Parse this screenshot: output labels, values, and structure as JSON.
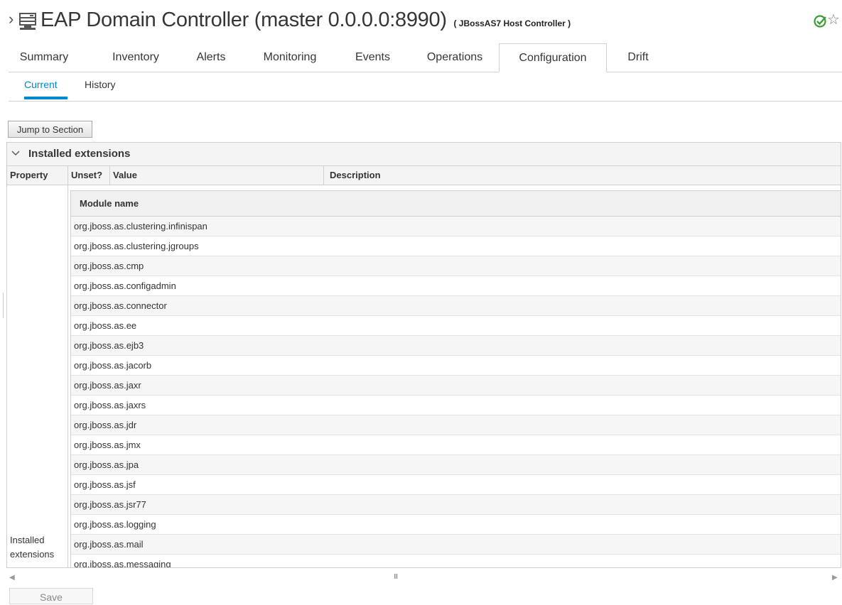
{
  "header": {
    "breadcrumb_caret": "›",
    "title": "EAP Domain Controller (master 0.0.0.0:8990)",
    "subtitle": "( JBossAS7 Host Controller )",
    "server_icon": "server-icon",
    "availability_icon": "check-circle-icon",
    "favorite_icon": "star-outline-icon",
    "favorite_glyph": "☆",
    "availability_color": "#3f9c35"
  },
  "tabs": [
    {
      "label": "Summary"
    },
    {
      "label": "Inventory"
    },
    {
      "label": "Alerts"
    },
    {
      "label": "Monitoring"
    },
    {
      "label": "Events"
    },
    {
      "label": "Operations"
    },
    {
      "label": "Configuration",
      "active": true
    },
    {
      "label": "Drift"
    }
  ],
  "subtabs": [
    {
      "label": "Current",
      "active": true
    },
    {
      "label": "History"
    }
  ],
  "accent_color": "#0088ce",
  "jump_button_label": "Jump to Section",
  "section": {
    "title": "Installed extensions",
    "columns": {
      "property": "Property",
      "unset": "Unset?",
      "value": "Value",
      "description": "Description"
    },
    "property_label": "Installed extensions",
    "inner_header": "Module name",
    "modules": [
      "org.jboss.as.clustering.infinispan",
      "org.jboss.as.clustering.jgroups",
      "org.jboss.as.cmp",
      "org.jboss.as.configadmin",
      "org.jboss.as.connector",
      "org.jboss.as.ee",
      "org.jboss.as.ejb3",
      "org.jboss.as.jacorb",
      "org.jboss.as.jaxr",
      "org.jboss.as.jaxrs",
      "org.jboss.as.jdr",
      "org.jboss.as.jmx",
      "org.jboss.as.jpa",
      "org.jboss.as.jsf",
      "org.jboss.as.jsr77",
      "org.jboss.as.logging",
      "org.jboss.as.mail",
      "org.jboss.as.messaging"
    ]
  },
  "scrollbar": {
    "left_glyph": "◀",
    "grip_glyph": "III",
    "right_glyph": "▶"
  },
  "save_label": "Save"
}
